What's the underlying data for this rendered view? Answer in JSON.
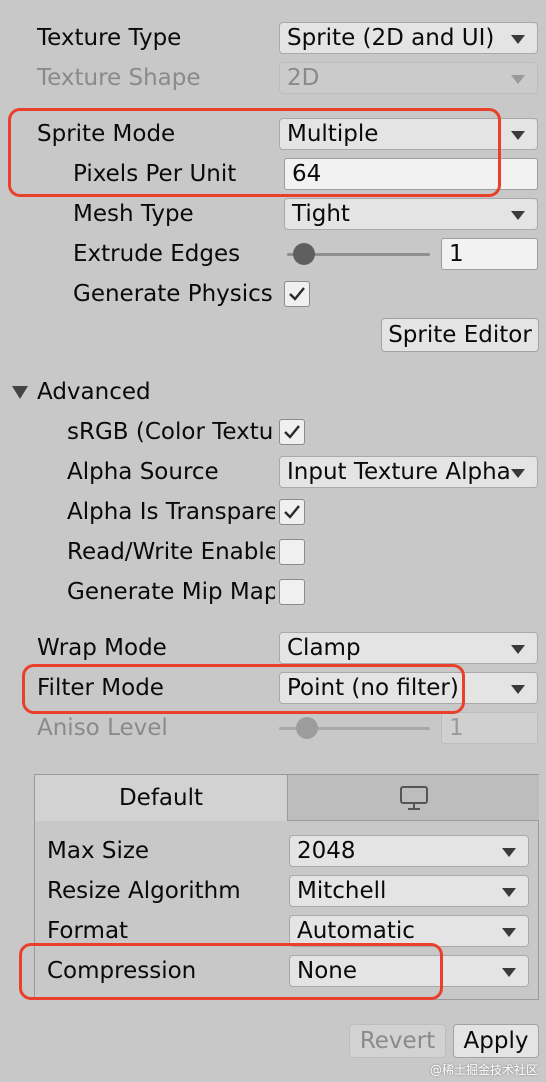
{
  "texture_type": {
    "label": "Texture Type",
    "value": "Sprite (2D and UI)"
  },
  "texture_shape": {
    "label": "Texture Shape",
    "value": "2D"
  },
  "sprite_mode": {
    "label": "Sprite Mode",
    "value": "Multiple"
  },
  "pixels_per_unit": {
    "label": "Pixels Per Unit",
    "value": "64"
  },
  "mesh_type": {
    "label": "Mesh Type",
    "value": "Tight"
  },
  "extrude_edges": {
    "label": "Extrude Edges",
    "value": "1",
    "slider_fraction": 0.05
  },
  "generate_physics": {
    "label": "Generate Physics S",
    "checked": true
  },
  "sprite_editor_button": "Sprite Editor",
  "advanced": {
    "header": "Advanced",
    "srgb": {
      "label": "sRGB (Color Textu",
      "checked": true
    },
    "alpha_source": {
      "label": "Alpha Source",
      "value": "Input Texture Alpha"
    },
    "alpha_is_transparency": {
      "label": "Alpha Is Transpare",
      "checked": true
    },
    "read_write": {
      "label": "Read/Write Enable",
      "checked": false
    },
    "mip_maps": {
      "label": "Generate Mip Map",
      "checked": false
    }
  },
  "wrap_mode": {
    "label": "Wrap Mode",
    "value": "Clamp"
  },
  "filter_mode": {
    "label": "Filter Mode",
    "value": "Point (no filter)"
  },
  "aniso_level": {
    "label": "Aniso Level",
    "value": "1",
    "slider_fraction": 0.1
  },
  "platform": {
    "tab_default": "Default",
    "tab_standalone_icon": "monitor-icon",
    "max_size": {
      "label": "Max Size",
      "value": "2048"
    },
    "resize_algorithm": {
      "label": "Resize Algorithm",
      "value": "Mitchell"
    },
    "format": {
      "label": "Format",
      "value": "Automatic"
    },
    "compression": {
      "label": "Compression",
      "value": "None"
    }
  },
  "footer": {
    "revert": "Revert",
    "apply": "Apply"
  },
  "watermark": "@稀土掘金技术社区",
  "colors": {
    "highlight": "#e8402a",
    "background": "#c8c8c8"
  }
}
